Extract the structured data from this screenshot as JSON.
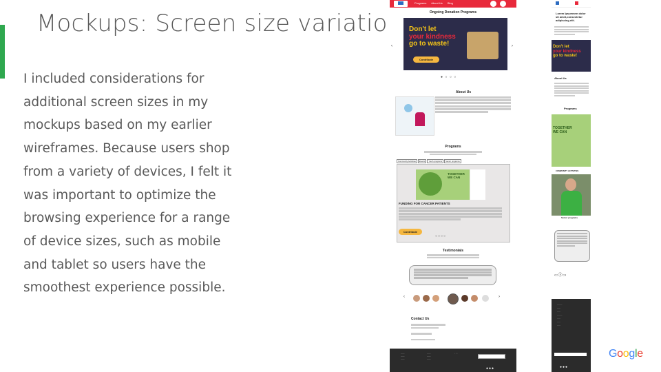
{
  "slide": {
    "title": "Mockups: Screen size variations",
    "body_lines": [
      "I included considerations for",
      "additional screen sizes in my",
      "mockups based on my earlier",
      "wireframes. Because users shop",
      "from a variety of devices, I felt it",
      "was important to optimize the",
      "browsing experience for a range",
      "of device sizes, such as mobile",
      "and tablet so users have the",
      "smoothest experience possible."
    ],
    "accent_color": "#2fa84f"
  },
  "desktop_mockup": {
    "nav_items": [
      "Programs",
      "About Us",
      "Blog"
    ],
    "section_title": "Ongoing Donation Programs",
    "banner_lines": [
      "Don't let",
      "your kindness",
      "go to waste!"
    ],
    "contribute_label": "Contribute",
    "about_heading": "About Us",
    "programs_heading": "Programs",
    "program_tabs": [
      "Community Activities",
      "Events",
      "Youth programs",
      "Senior programs"
    ],
    "tree_text": [
      "TOGETHER",
      "WE CAN"
    ],
    "funding_heading": "FUNDING FOR CANCER PATIENTS",
    "testimonials_heading": "Testimonials",
    "contact_heading": "Contact Us",
    "brand_color": "#e8293b"
  },
  "mobile_mockup": {
    "header_lines": [
      "Lorem Ipsumnnn dolor",
      "sit amet,consectetur",
      "adipiscing elit."
    ],
    "banner_lines": [
      "Don't let",
      "your kindness",
      "go to waste!"
    ],
    "about_heading": "About Us",
    "programs_heading": "Programs",
    "tree_text": [
      "TOGETHER",
      "WE CAN"
    ],
    "community_heading": "COMMUNITY ACTIVITIES",
    "senior_heading": "Senior programs"
  },
  "logo_text": "Google",
  "logo_letters": [
    "G",
    "o",
    "o",
    "g",
    "l",
    "e"
  ]
}
